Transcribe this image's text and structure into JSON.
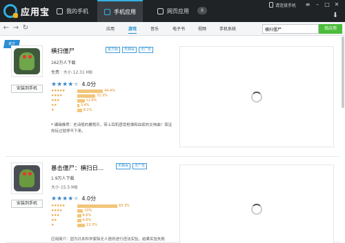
{
  "app": {
    "name": "应用宝"
  },
  "titlebar": {
    "tabs": [
      {
        "label": "我的手机",
        "icon": "phone-icon"
      },
      {
        "label": "手机应用",
        "icon": "apps-icon"
      },
      {
        "label": "网页应用",
        "icon": "web-icon"
      }
    ],
    "badge": "8",
    "connect_label": "请连接手机"
  },
  "toolbar": {
    "categories": [
      "应用",
      "游戏",
      "音乐",
      "电子书",
      "视频",
      "手机系统"
    ],
    "active_category": "游戏",
    "search_value": "横扫僵尸",
    "search_button": "找应用"
  },
  "cards": [
    {
      "ribbon": "官方",
      "title": "横扫僵尸",
      "tags": [
        "官方版",
        "无病毒",
        "无广告"
      ],
      "downloads": "162万人下载",
      "meta": "免费 · 大小 12.31 MB",
      "install_label": "安装到手机",
      "rating": 4,
      "score": "4.0分",
      "distribution": [
        {
          "stars": 5,
          "pct": "44.4%",
          "value": 44.4
        },
        {
          "stars": 4,
          "pct": "31.3%",
          "value": 31.3
        },
        {
          "stars": 3,
          "pct": "12.6%",
          "value": 12.6
        },
        {
          "stars": 2,
          "pct": "3.4%",
          "value": 3.4
        },
        {
          "stars": 1,
          "pct": "8.1%",
          "value": 8.1
        }
      ],
      "description": "编辑推荐：史诗般的屠戮乐，带上耳机感受枪弹和血浆的交响曲！保证你玩过就停不下来。"
    },
    {
      "title": "暴击僵尸：横扫日...",
      "tags": [
        "无病毒",
        "无广告"
      ],
      "downloads": "1.9万人下载",
      "meta": "大小 15.5 MB",
      "install_label": "安装到手机",
      "rating": 4,
      "score": "4.0分",
      "distribution": [
        {
          "stars": 5,
          "pct": "83.3%",
          "value": 83.3
        },
        {
          "stars": 4,
          "pct": "10%",
          "value": 10
        },
        {
          "stars": 3,
          "pct": "6.6%",
          "value": 6.6
        },
        {
          "stars": 2,
          "pct": "6.6%",
          "value": 6.6
        },
        {
          "stars": 1,
          "pct": "13.3%",
          "value": 13.3
        }
      ],
      "description": "应用简介：因为日本科学家除无人居的进行违法实验，结果实验失败"
    }
  ]
}
